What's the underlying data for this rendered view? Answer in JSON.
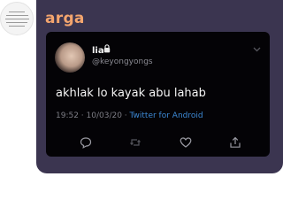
{
  "chat": {
    "sender_name": "arga",
    "sender_color": "#f3a56e",
    "bubble_color": "#3b3550"
  },
  "tweet": {
    "display_name": "lia",
    "handle": "@keyongyongs",
    "text": "akhlak lo kayak abu lahab",
    "time_date": "19:52 · 10/03/20 · ",
    "client": "Twitter for Android",
    "client_color": "#3d8ad6",
    "icons": {
      "lock": "lock-icon",
      "menu": "chevron-down-icon",
      "reply": "reply-icon",
      "retweet": "retweet-icon",
      "like": "like-icon",
      "share": "share-icon"
    }
  }
}
